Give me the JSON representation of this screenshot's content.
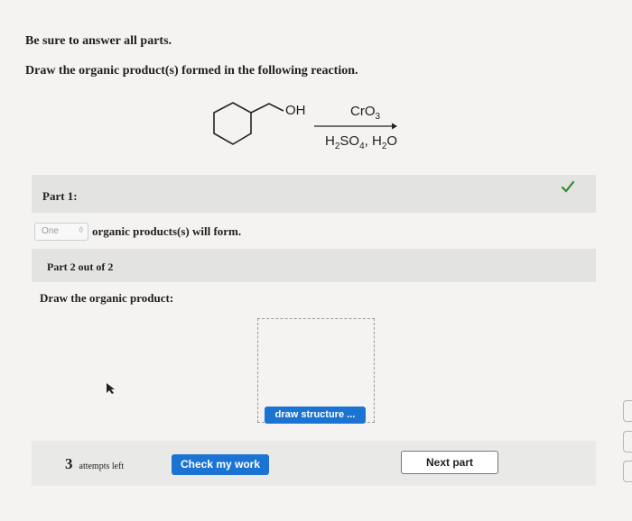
{
  "question": {
    "instruction": "Be sure to answer all parts.",
    "prompt": "Draw the organic product(s) formed in the following reaction."
  },
  "reaction": {
    "reactant_label": "OH",
    "reagent_top": "CrO",
    "reagent_top_sub": "3",
    "reagent_bottom_parts": [
      "H",
      "2",
      "SO",
      "4",
      ", H",
      "2",
      "O"
    ]
  },
  "part1": {
    "title": "Part 1:",
    "select_value": "One",
    "statement": "organic products(s) will form.",
    "status_icon": "check-icon",
    "status_color": "#2e8b2e"
  },
  "part2": {
    "title": "Part 2 out of 2",
    "prompt": "Draw the organic product:",
    "draw_button": "draw structure ..."
  },
  "footer": {
    "attempts_count": "3",
    "attempts_label": "attempts left",
    "check_button": "Check my work",
    "next_button": "Next part"
  },
  "colors": {
    "accent": "#1c74d2",
    "band": "#e3e3e2",
    "background": "#f4f3f1"
  }
}
